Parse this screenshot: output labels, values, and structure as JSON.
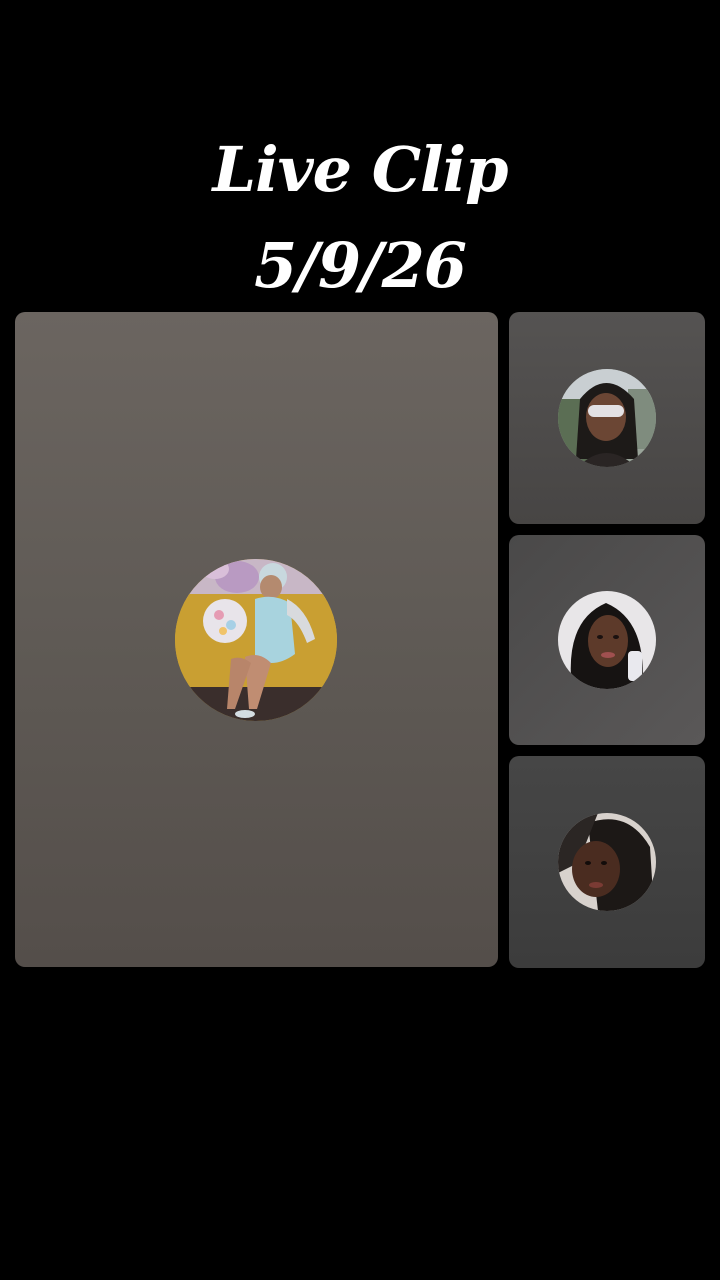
{
  "title": {
    "line1": "Live Clip",
    "line2": "5/9/26"
  },
  "participants": [
    {
      "role": "host",
      "avatar": "host-avatar"
    },
    {
      "role": "guest",
      "avatar": "guest-1-avatar"
    },
    {
      "role": "guest",
      "avatar": "guest-2-avatar"
    },
    {
      "role": "guest",
      "avatar": "guest-3-avatar"
    }
  ],
  "colors": {
    "background": "#000000",
    "tile": "#5f5a55",
    "title_text": "#ffffff"
  }
}
